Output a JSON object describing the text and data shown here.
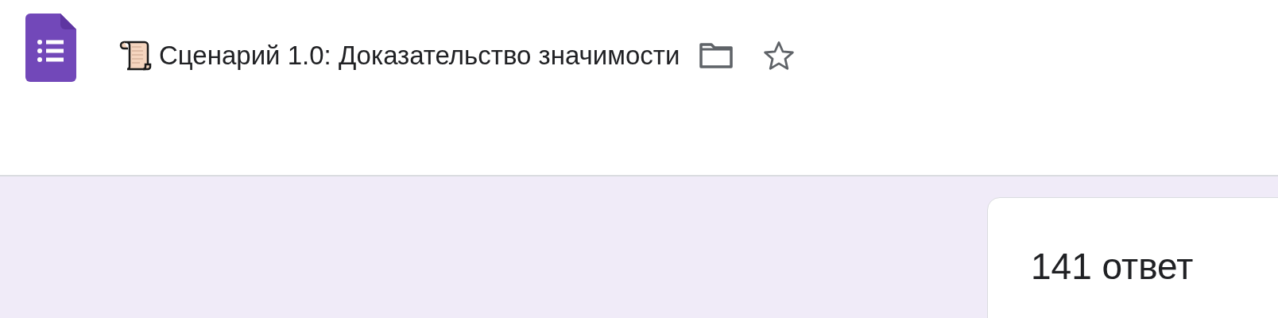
{
  "header": {
    "title": "Сценарий 1.0: Доказательство значимости"
  },
  "summary_card": {
    "responses": "141 ответ"
  }
}
